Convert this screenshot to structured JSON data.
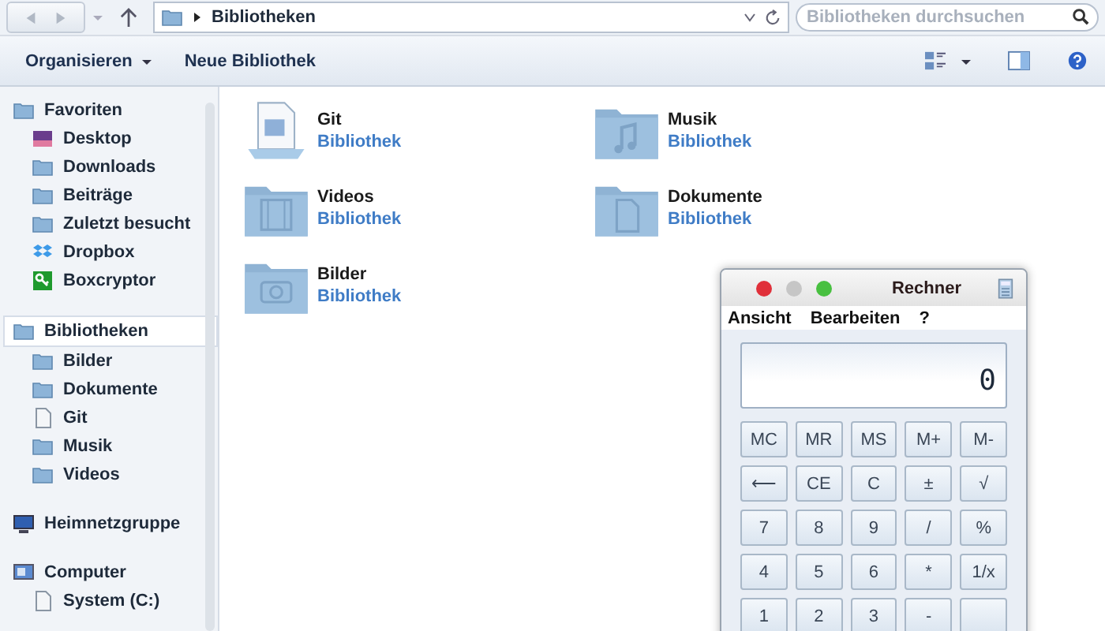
{
  "address": {
    "path": "Bibliotheken"
  },
  "search": {
    "placeholder": "Bibliotheken durchsuchen"
  },
  "toolbar": {
    "buttons": [
      {
        "label": "Organisieren",
        "dropdown": true
      },
      {
        "label": "Neue Bibliothek",
        "dropdown": false
      }
    ]
  },
  "sidebar": {
    "groups": [
      {
        "label": "Favoriten",
        "kind": "star",
        "selected": false,
        "children": [
          {
            "label": "Desktop",
            "kind": "desktop"
          },
          {
            "label": "Downloads",
            "kind": "folder"
          },
          {
            "label": "Beiträge",
            "kind": "folder"
          },
          {
            "label": "Zuletzt besucht",
            "kind": "folder"
          },
          {
            "label": "Dropbox",
            "kind": "dropbox"
          },
          {
            "label": "Boxcryptor",
            "kind": "boxcryptor"
          }
        ]
      },
      {
        "label": "Bibliotheken",
        "kind": "folder",
        "selected": true,
        "children": [
          {
            "label": "Bilder",
            "kind": "folder"
          },
          {
            "label": "Dokumente",
            "kind": "folder"
          },
          {
            "label": "Git",
            "kind": "document"
          },
          {
            "label": "Musik",
            "kind": "folder"
          },
          {
            "label": "Videos",
            "kind": "folder"
          }
        ]
      },
      {
        "label": "Heimnetzgruppe",
        "kind": "network",
        "selected": false
      },
      {
        "label": "Computer",
        "kind": "computer",
        "selected": false,
        "children": [
          {
            "label": "System (C:)",
            "kind": "drive"
          }
        ]
      }
    ]
  },
  "libraries": [
    {
      "name": "Git",
      "type": "Bibliothek",
      "kind": "document"
    },
    {
      "name": "Musik",
      "type": "Bibliothek",
      "kind": "music"
    },
    {
      "name": "Videos",
      "type": "Bibliothek",
      "kind": "video"
    },
    {
      "name": "Dokumente",
      "type": "Bibliothek",
      "kind": "page"
    },
    {
      "name": "Bilder",
      "type": "Bibliothek",
      "kind": "camera"
    }
  ],
  "calculator": {
    "title": "Rechner",
    "menu": [
      "Ansicht",
      "Bearbeiten",
      "?"
    ],
    "display": "0",
    "keys": [
      [
        "MC",
        "MR",
        "MS",
        "M+",
        "M-"
      ],
      [
        "⟵",
        "CE",
        "C",
        "±",
        "√"
      ],
      [
        "7",
        "8",
        "9",
        "/",
        "%"
      ],
      [
        "4",
        "5",
        "6",
        "*",
        "1/x"
      ],
      [
        "1",
        "2",
        "3",
        "-"
      ]
    ]
  }
}
